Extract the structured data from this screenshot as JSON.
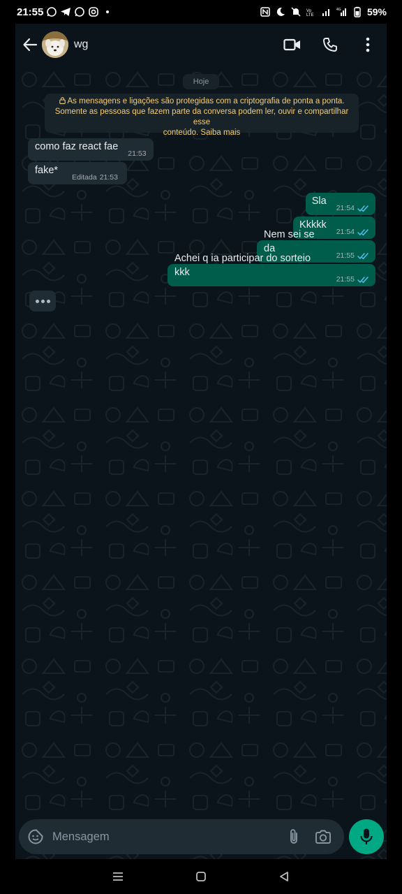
{
  "status_bar": {
    "time": "21:55",
    "battery": "59%",
    "left_icons": [
      "whatsapp-icon",
      "telegram-icon",
      "whatsapp-icon",
      "instagram-icon"
    ],
    "right_icons": [
      "nfc-icon",
      "moon-icon",
      "mute-icon",
      "volte-icon",
      "signal-icon",
      "4g-signal-icon",
      "battery-icon"
    ]
  },
  "header": {
    "contact_name": "wg",
    "actions": [
      "video-call-icon",
      "voice-call-icon",
      "more-icon"
    ]
  },
  "conversation": {
    "date_chip": "Hoje",
    "encryption_notice": {
      "line1": "As mensagens e ligações são protegidas com a criptografia de ponta a ponta.",
      "line2": "Somente as pessoas que fazem parte da conversa podem ler, ouvir e compartilhar esse",
      "line3": "conteúdo. Saiba mais"
    },
    "messages": [
      {
        "direction": "in",
        "text": "como faz react fae",
        "time": "21:53",
        "edited": ""
      },
      {
        "direction": "in",
        "text": "fake*",
        "time": "21:53",
        "edited": "Editada"
      },
      {
        "direction": "out",
        "text": "Sla",
        "time": "21:54",
        "status": "read"
      },
      {
        "direction": "out",
        "text": "Kkkkk",
        "time": "21:54",
        "status": "read"
      },
      {
        "direction": "out",
        "text": "Nem sei se da",
        "time": "21:55",
        "status": "read"
      },
      {
        "direction": "out",
        "text": "Achei q ia participar do sorteio kkk",
        "time": "21:55",
        "status": "read"
      }
    ],
    "typing_indicator": true
  },
  "input_bar": {
    "placeholder": "Mensagem"
  },
  "colors": {
    "background": "#0b141a",
    "incoming_bubble": "#202c33",
    "outgoing_bubble": "#005c4b",
    "accent": "#00a884",
    "read_ticks": "#53bdeb",
    "notice_text": "#f7cd74"
  }
}
